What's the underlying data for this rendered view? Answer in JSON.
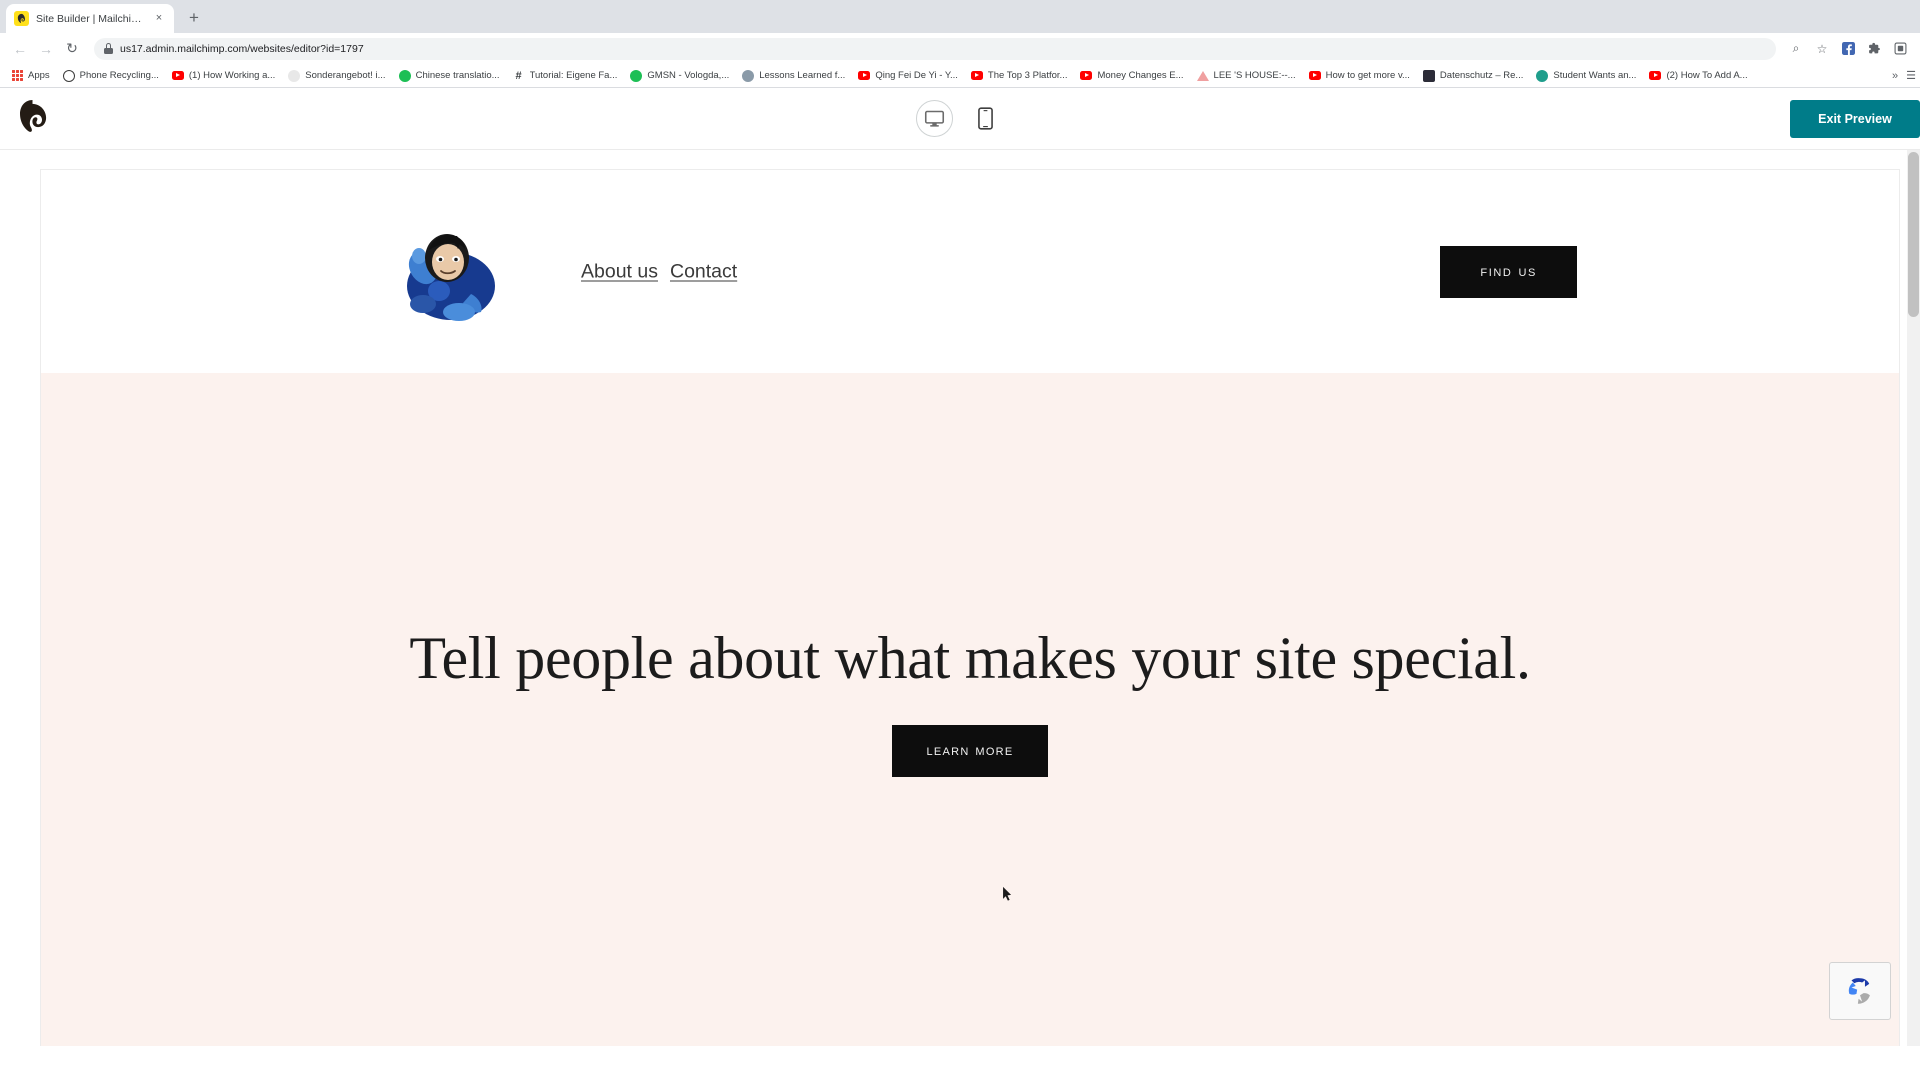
{
  "browser": {
    "tab": {
      "title": "Site Builder | Mailchimp",
      "favicon": "mailchimp-favicon",
      "close_label": "×"
    },
    "new_tab_label": "+",
    "nav": {
      "back": "←",
      "forward": "→",
      "reload": "↻"
    },
    "omnibox": {
      "url": "us17.admin.mailchimp.com/websites/editor?id=1797",
      "lock": "site-security-lock"
    },
    "toolbar_right": [
      {
        "name": "zoom-search-icon",
        "glyph": "⌕"
      },
      {
        "name": "bookmark-star-icon",
        "glyph": "☆"
      },
      {
        "name": "facebook-extension-icon",
        "glyph": "f"
      },
      {
        "name": "extensions-puzzle-icon",
        "glyph": "❖"
      },
      {
        "name": "profile-avatar-icon",
        "glyph": "▣"
      }
    ],
    "bookmarks_label": "Apps",
    "bookmarks": [
      {
        "label": "Phone Recycling...",
        "icon": "circle",
        "color": "#ffffff"
      },
      {
        "label": "(1) How Working a...",
        "icon": "youtube",
        "color": "#ff0000"
      },
      {
        "label": "Sonderangebot! i...",
        "icon": "circle",
        "color": "#eaeaea"
      },
      {
        "label": "Chinese translatio...",
        "icon": "circle",
        "color": "#1dbf55"
      },
      {
        "label": "Tutorial: Eigene Fa...",
        "icon": "hash",
        "color": "#4a4a4a"
      },
      {
        "label": "GMSN - Vologda,...",
        "icon": "circle",
        "color": "#1dbf55"
      },
      {
        "label": "Lessons Learned f...",
        "icon": "circle",
        "color": "#8a9aa8"
      },
      {
        "label": "Qing Fei De Yi - Y...",
        "icon": "youtube",
        "color": "#ff0000"
      },
      {
        "label": "The Top 3 Platfor...",
        "icon": "youtube",
        "color": "#ff0000"
      },
      {
        "label": "Money Changes E...",
        "icon": "youtube",
        "color": "#ff0000"
      },
      {
        "label": "LEE 'S HOUSE:--...",
        "icon": "triangle",
        "color": "#f2a0a0"
      },
      {
        "label": "How to get more v...",
        "icon": "youtube",
        "color": "#ff0000"
      },
      {
        "label": "Datenschutz – Re...",
        "icon": "circle",
        "color": "#2c2c38"
      },
      {
        "label": "Student Wants an...",
        "icon": "circle",
        "color": "#1f9e8c"
      },
      {
        "label": "(2) How To Add A...",
        "icon": "youtube",
        "color": "#ff0000"
      }
    ],
    "bookmarks_overflow": "»",
    "bookmarks_reading_list": "☰"
  },
  "mailchimp": {
    "logo_name": "mailchimp-freddie-logo",
    "devices": [
      {
        "name": "desktop-view-toggle",
        "label": "Desktop",
        "active": true
      },
      {
        "name": "mobile-view-toggle",
        "label": "Mobile",
        "active": false
      }
    ],
    "exit_preview_label": "Exit Preview",
    "accent_color": "#007c89"
  },
  "site": {
    "logo_alt": "superhero-character-logo",
    "nav": [
      {
        "label": "About us"
      },
      {
        "label": "Contact"
      }
    ],
    "find_us_label": "Find Us",
    "hero": {
      "headline": "Tell people about what makes your site special.",
      "cta_label": "Learn More",
      "background_color": "#fcf2ee"
    },
    "recaptcha_label": "reCAPTCHA"
  }
}
